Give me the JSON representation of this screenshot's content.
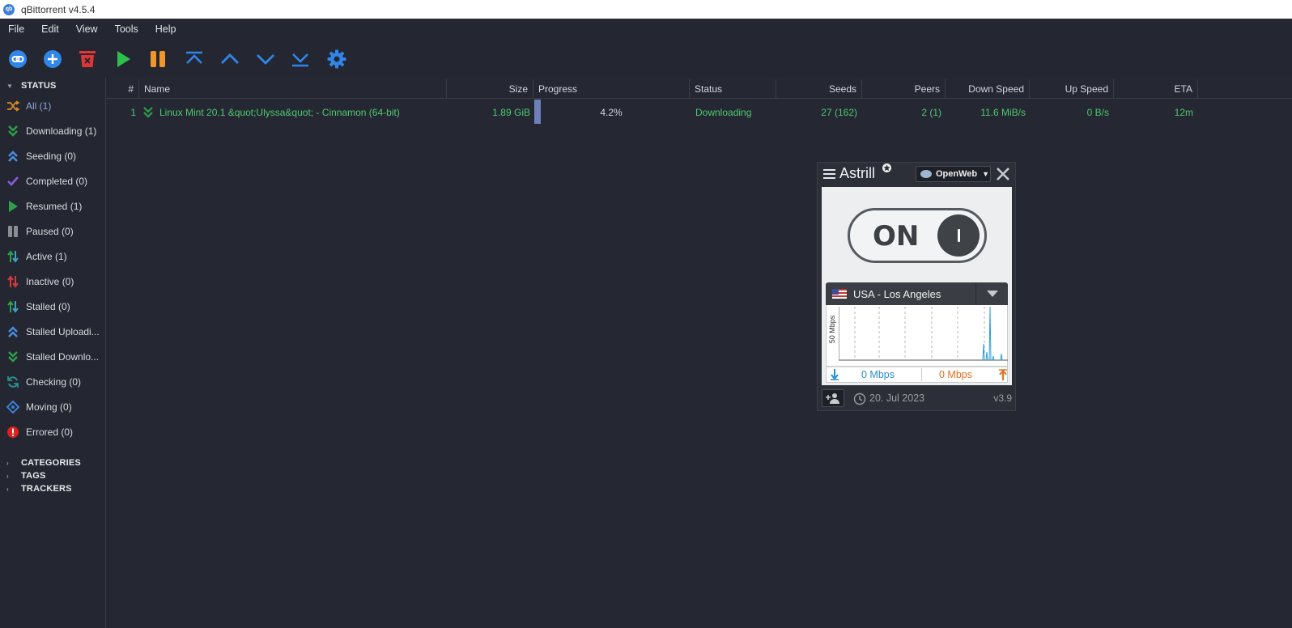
{
  "window": {
    "title": "qBittorrent v4.5.4",
    "icon": "qb"
  },
  "menu": [
    "File",
    "Edit",
    "View",
    "Tools",
    "Help"
  ],
  "toolbar": {
    "buttons": [
      "add-link",
      "add-torrent",
      "delete",
      "resume",
      "pause",
      "top-priority",
      "increase-priority",
      "decrease-priority",
      "bottom-priority",
      "options"
    ]
  },
  "sidebar": {
    "status_header": "STATUS",
    "items": [
      {
        "label": "All (1)",
        "icon": "shuffle-icon",
        "color": "#d98a2b"
      },
      {
        "label": "Downloading (1)",
        "icon": "double-chevron-down-icon",
        "color": "#2ea04a"
      },
      {
        "label": "Seeding (0)",
        "icon": "double-chevron-up-icon",
        "color": "#4a8ee0"
      },
      {
        "label": "Completed (0)",
        "icon": "checkmark-icon",
        "color": "#8a5ad8"
      },
      {
        "label": "Resumed (1)",
        "icon": "play-icon",
        "color": "#2ea04a"
      },
      {
        "label": "Paused (0)",
        "icon": "pause-icon",
        "color": "#8a8d94"
      },
      {
        "label": "Active (1)",
        "icon": "up-down-arrows-icon",
        "color": "#2ea04a"
      },
      {
        "label": "Inactive (0)",
        "icon": "up-down-arrows-icon",
        "color": "#d63a3a"
      },
      {
        "label": "Stalled (0)",
        "icon": "up-down-arrows-icon",
        "color": "#3aa0c8"
      },
      {
        "label": "Stalled Uploadi...",
        "icon": "double-chevron-up-icon",
        "color": "#4a8ee0"
      },
      {
        "label": "Stalled Downlo...",
        "icon": "double-chevron-down-icon",
        "color": "#2ea04a"
      },
      {
        "label": "Checking (0)",
        "icon": "refresh-icon",
        "color": "#2a8d8d"
      },
      {
        "label": "Moving (0)",
        "icon": "move-icon",
        "color": "#3c7fd6"
      },
      {
        "label": "Errored (0)",
        "icon": "error-icon",
        "color": "#e02020"
      }
    ],
    "sections": [
      "CATEGORIES",
      "TAGS",
      "TRACKERS"
    ]
  },
  "table": {
    "columns": [
      "#",
      "Name",
      "Size",
      "Progress",
      "Status",
      "Seeds",
      "Peers",
      "Down Speed",
      "Up Speed",
      "ETA"
    ],
    "rows": [
      {
        "num": "1",
        "name": "Linux Mint 20.1 &quot;Ulyssa&quot; - Cinnamon (64-bit)",
        "size": "1.89 GiB",
        "progress": "4.2%",
        "progress_value": 0.042,
        "status": "Downloading",
        "seeds": "27 (162)",
        "peers": "2 (1)",
        "down_speed": "11.6 MiB/s",
        "up_speed": "0 B/s",
        "eta": "12m"
      }
    ]
  },
  "astrill": {
    "brand": "Astrill",
    "mode": "OpenWeb",
    "toggle_label": "ON",
    "location": "USA - Los Angeles",
    "graph_ylabel": "50 Mbps",
    "download_speed": "0 Mbps",
    "upload_speed": "0 Mbps",
    "date": "20. Jul 2023",
    "version": "v3.9",
    "colors": {
      "download": "#2a8fd0",
      "upload": "#e07020"
    }
  }
}
